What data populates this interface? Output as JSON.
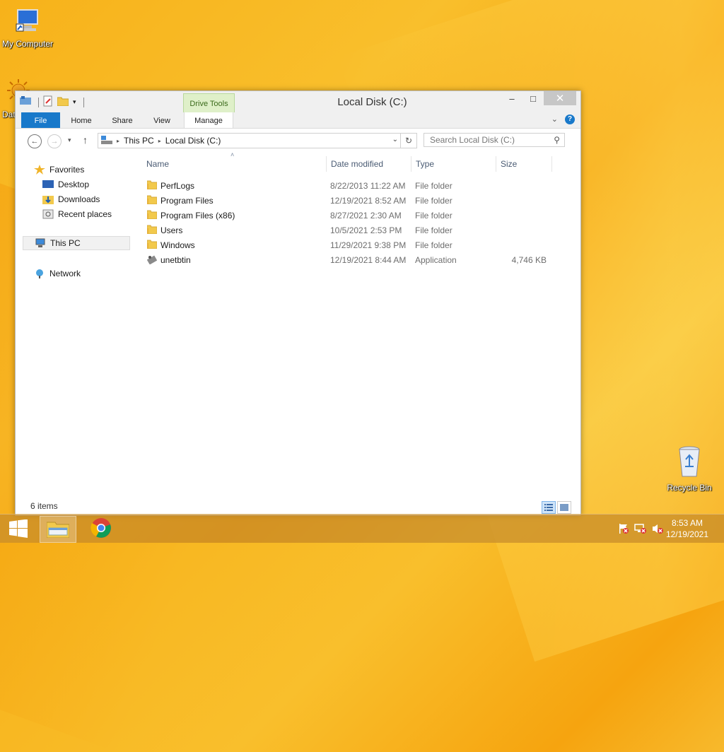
{
  "desktop": {
    "icons": [
      {
        "label": "My Computer"
      },
      {
        "label": "Dat"
      },
      {
        "label": "Recycle Bin"
      }
    ]
  },
  "window": {
    "title": "Local Disk (C:)",
    "contextual_tab_group": "Drive Tools",
    "tabs": [
      "File",
      "Home",
      "Share",
      "View",
      "Manage"
    ],
    "minimize": "–",
    "maximize": "□",
    "close": "✕",
    "help": "?"
  },
  "addressbar": {
    "breadcrumb": [
      "This PC",
      "Local Disk (C:)"
    ],
    "search_placeholder": "Search Local Disk (C:)"
  },
  "navpane": {
    "favorites": "Favorites",
    "desktop": "Desktop",
    "downloads": "Downloads",
    "recent": "Recent places",
    "thispc": "This PC",
    "network": "Network"
  },
  "filelist": {
    "columns": {
      "name": "Name",
      "date": "Date modified",
      "type": "Type",
      "size": "Size"
    },
    "rows": [
      {
        "name": "PerfLogs",
        "date": "8/22/2013 11:22 AM",
        "type": "File folder",
        "size": ""
      },
      {
        "name": "Program Files",
        "date": "12/19/2021 8:52 AM",
        "type": "File folder",
        "size": ""
      },
      {
        "name": "Program Files (x86)",
        "date": "8/27/2021 2:30 AM",
        "type": "File folder",
        "size": ""
      },
      {
        "name": "Users",
        "date": "10/5/2021 2:53 PM",
        "type": "File folder",
        "size": ""
      },
      {
        "name": "Windows",
        "date": "11/29/2021 9:38 PM",
        "type": "File folder",
        "size": ""
      },
      {
        "name": "unetbtin",
        "date": "12/19/2021 8:44 AM",
        "type": "Application",
        "size": "4,746 KB"
      }
    ]
  },
  "status": {
    "items_count": "6 items"
  },
  "taskbar": {
    "time": "8:53 AM",
    "date": "12/19/2021"
  },
  "colors": {
    "accent": "#1979ca",
    "drive_tools": "#dff0c9"
  }
}
